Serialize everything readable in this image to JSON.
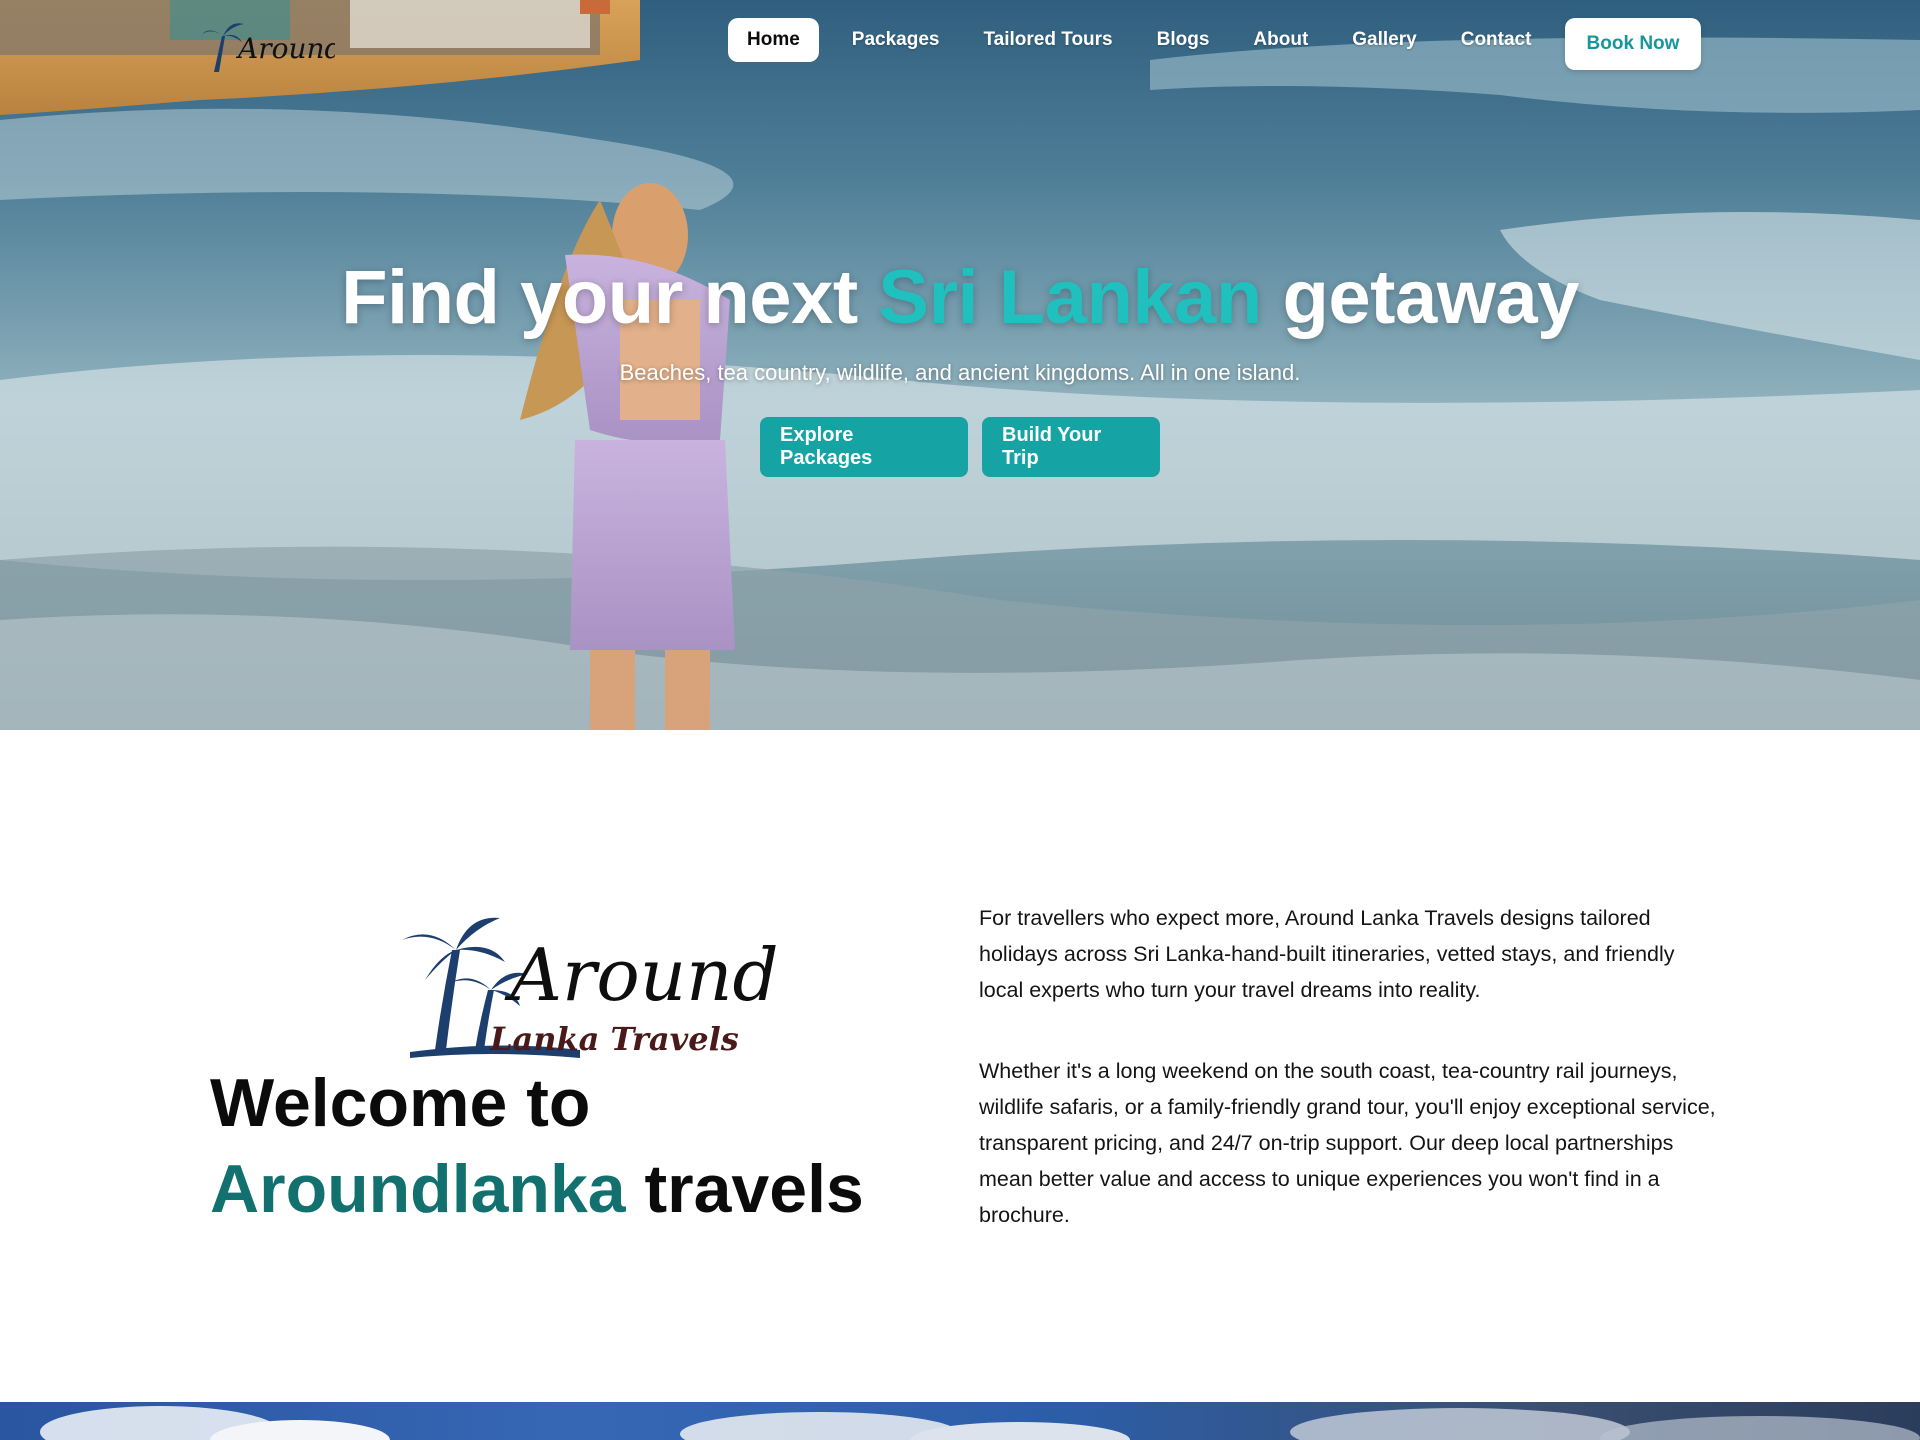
{
  "brand": {
    "logo_word": "Around",
    "logo_sub": "Lanka Travels"
  },
  "nav": {
    "items": [
      "Home",
      "Packages",
      "Tailored Tours",
      "Blogs",
      "About",
      "Gallery",
      "Contact"
    ],
    "active": "Home",
    "cta_label": "Book Now"
  },
  "hero": {
    "title_before": "Find your next ",
    "title_accent": "Sri Lankan",
    "title_after": " getaway",
    "subtitle": "Beaches, tea country, wildlife, and ancient kingdoms. All in one island.",
    "primary_button": "Explore Packages",
    "secondary_button": "Build Your Trip"
  },
  "welcome": {
    "title_line1": "Welcome to",
    "title_accent": "Aroundlanka",
    "title_rest": " travels",
    "paragraph1": "For travellers who expect more, Around Lanka Travels designs tailored holidays across Sri Lanka-hand-built itineraries, vetted stays, and friendly local experts who turn your travel dreams into reality.",
    "paragraph2": "Whether it's a long weekend on the south coast, tea-country rail journeys, wildlife safaris, or a family-friendly grand tour, you'll enjoy exceptional service, transparent pricing, and 24/7 on-trip support. Our deep local partnerships mean better value and access to unique experiences you won't find in a brochure."
  },
  "colors": {
    "accent_teal": "#20c0bf",
    "button_teal": "#16a3a4",
    "dark_teal": "#12706e",
    "logo_navy": "#1c3f6e"
  },
  "icons": [
    "palm-tree-icon"
  ]
}
